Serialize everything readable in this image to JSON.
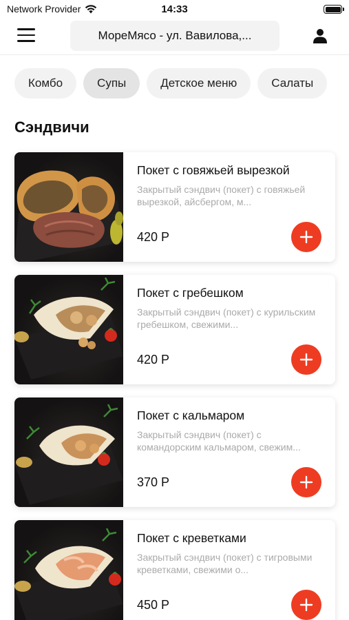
{
  "status_bar": {
    "carrier": "Network Provider",
    "time": "14:33",
    "icons": [
      "wifi-icon",
      "battery-icon"
    ]
  },
  "header": {
    "menu_icon": "hamburger-icon",
    "address": "МореМясо - ул. Вавилова,...",
    "profile_icon": "user-icon"
  },
  "categories": [
    {
      "label": "Комбо",
      "active": false
    },
    {
      "label": "Супы",
      "active": true
    },
    {
      "label": "Детское меню",
      "active": false
    },
    {
      "label": "Салаты",
      "active": false
    }
  ],
  "section": {
    "title": "Сэндвичи"
  },
  "products": [
    {
      "title": "Покет с говяжьей вырезкой",
      "description": "Закрытый сэндвич (покет) с говяжьей вырезкой, айсбергом, м...",
      "price": "420 Р"
    },
    {
      "title": "Покет с гребешком",
      "description": "Закрытый сэндвич (покет) с курильским гребешком, свежими...",
      "price": "420 Р"
    },
    {
      "title": "Покет с кальмаром",
      "description": "Закрытый сэндвич (покет) с командорским кальмаром, свежим...",
      "price": "370 Р"
    },
    {
      "title": "Покет с креветками",
      "description": "Закрытый сэндвич (покет) с тигровыми креветками, свежими о...",
      "price": "450 Р"
    }
  ],
  "colors": {
    "accent": "#ee3c22",
    "chip_bg": "#f2f2f2",
    "chip_active_bg": "#e4e4e4",
    "muted_text": "#aaaaaa"
  },
  "add_button_icon": "plus-icon"
}
